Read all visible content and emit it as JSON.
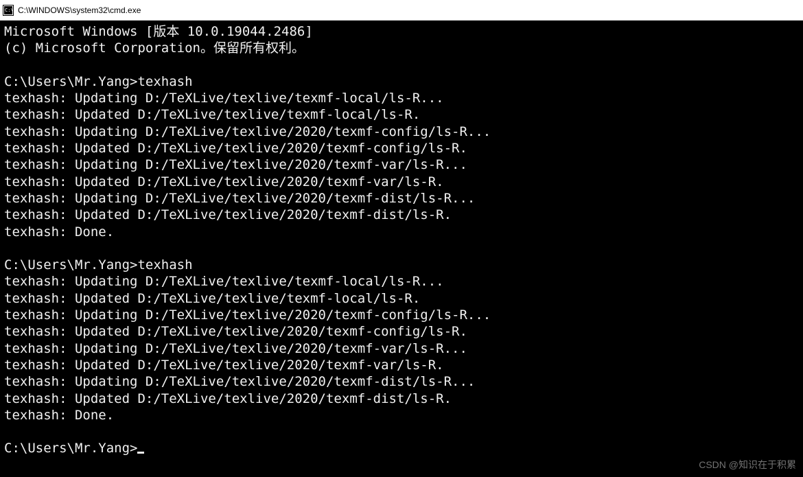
{
  "titlebar": {
    "text": "C:\\WINDOWS\\system32\\cmd.exe"
  },
  "lines": [
    "Microsoft Windows [版本 10.0.19044.2486]",
    "(c) Microsoft Corporation。保留所有权利。",
    "",
    "C:\\Users\\Mr.Yang>texhash",
    "texhash: Updating D:/TeXLive/texlive/texmf-local/ls-R...",
    "texhash: Updated D:/TeXLive/texlive/texmf-local/ls-R.",
    "texhash: Updating D:/TeXLive/texlive/2020/texmf-config/ls-R...",
    "texhash: Updated D:/TeXLive/texlive/2020/texmf-config/ls-R.",
    "texhash: Updating D:/TeXLive/texlive/2020/texmf-var/ls-R...",
    "texhash: Updated D:/TeXLive/texlive/2020/texmf-var/ls-R.",
    "texhash: Updating D:/TeXLive/texlive/2020/texmf-dist/ls-R...",
    "texhash: Updated D:/TeXLive/texlive/2020/texmf-dist/ls-R.",
    "texhash: Done.",
    "",
    "C:\\Users\\Mr.Yang>texhash",
    "texhash: Updating D:/TeXLive/texlive/texmf-local/ls-R...",
    "texhash: Updated D:/TeXLive/texlive/texmf-local/ls-R.",
    "texhash: Updating D:/TeXLive/texlive/2020/texmf-config/ls-R...",
    "texhash: Updated D:/TeXLive/texlive/2020/texmf-config/ls-R.",
    "texhash: Updating D:/TeXLive/texlive/2020/texmf-var/ls-R...",
    "texhash: Updated D:/TeXLive/texlive/2020/texmf-var/ls-R.",
    "texhash: Updating D:/TeXLive/texlive/2020/texmf-dist/ls-R...",
    "texhash: Updated D:/TeXLive/texlive/2020/texmf-dist/ls-R.",
    "texhash: Done.",
    ""
  ],
  "prompt": "C:\\Users\\Mr.Yang>",
  "watermark": "CSDN @知识在于积累"
}
